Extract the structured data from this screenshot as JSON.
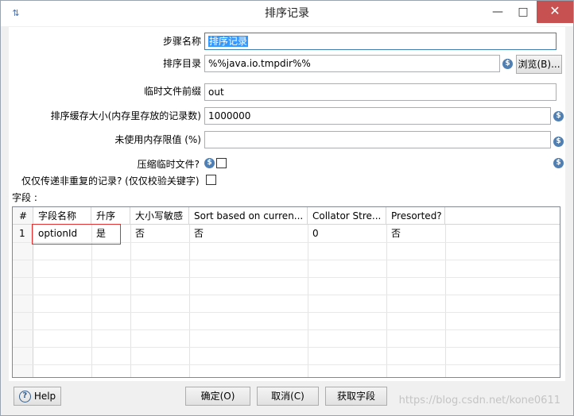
{
  "window": {
    "title": "排序记录",
    "minimize": "—",
    "maximize": "□",
    "close": "✕"
  },
  "form": {
    "step_name_label": "步骤名称",
    "step_name_value": "排序记录",
    "sort_dir_label": "排序目录",
    "sort_dir_value": "%%java.io.tmpdir%%",
    "browse_button": "浏览(B)...",
    "temp_prefix_label": "临时文件前缀",
    "temp_prefix_value": "out",
    "cache_size_label": "排序缓存大小(内存里存放的记录数)",
    "cache_size_value": "1000000",
    "free_mem_label": "未使用内存限值 (%)",
    "free_mem_value": "",
    "compress_label": "压缩临时文件?",
    "unique_label": "仅仅传递非重复的记录? (仅仅校验关键字)",
    "fields_label": "字段 :"
  },
  "table": {
    "headers": [
      "#",
      "字段名称",
      "升序",
      "大小写敏感",
      "Sort based on curren...",
      "Collator Stre...",
      "Presorted?"
    ],
    "rows": [
      [
        "1",
        "optionId",
        "是",
        "否",
        "否",
        "0",
        "否"
      ]
    ]
  },
  "buttons": {
    "help": "Help",
    "ok": "确定(O)",
    "cancel": "取消(C)",
    "get_fields": "获取字段"
  },
  "watermark": "https://blog.csdn.net/kone0611",
  "colors": {
    "accent": "#3399ff",
    "close_button": "#c75050",
    "highlight_box": "#e03030",
    "variable_icon": "#4f7fb3"
  }
}
